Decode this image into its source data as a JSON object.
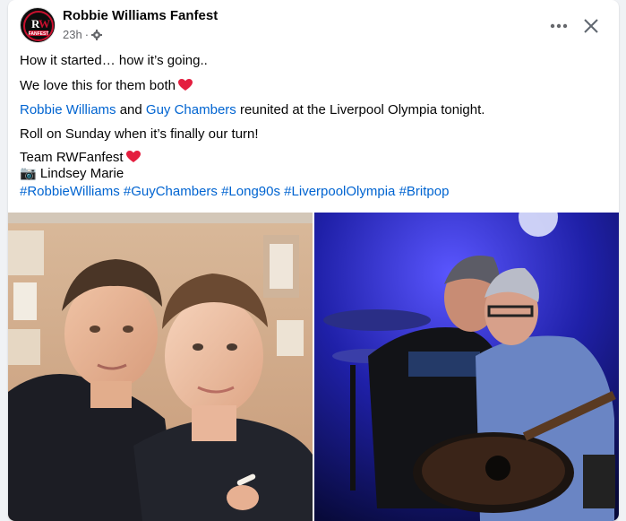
{
  "post": {
    "page_name": "Robbie Williams Fanfest",
    "time": "23h",
    "separator": "·",
    "avatar_logo_text": "RW FANFEST",
    "icons": {
      "audience": "gear-icon",
      "more": "more-options-icon",
      "close": "close-icon",
      "heart": "red-heart-emoji",
      "camera": "camera-emoji"
    },
    "lines": {
      "l1": "How it started… how it’s going..",
      "l2": "We love this for them both",
      "l3_link1": "Robbie Williams",
      "l3_and": " and ",
      "l3_link2": "Guy Chambers",
      "l3_rest": " reunited at the Liverpool Olympia tonight.",
      "l4": "Roll on Sunday when it’s finally our turn!",
      "l5": "Team RWFanfest",
      "l6_camera": "📷",
      "l6_text": " Lindsey Marie",
      "hashtags": [
        "#RobbieWilliams",
        "#GuyChambers",
        "#Long90s",
        "#LiverpoolOlympia",
        "#Britpop"
      ]
    },
    "photos": [
      "photo-then",
      "photo-now"
    ]
  },
  "colors": {
    "link": "#0064d1",
    "heart": "#e41e3f",
    "secondary_text": "#65676b"
  }
}
